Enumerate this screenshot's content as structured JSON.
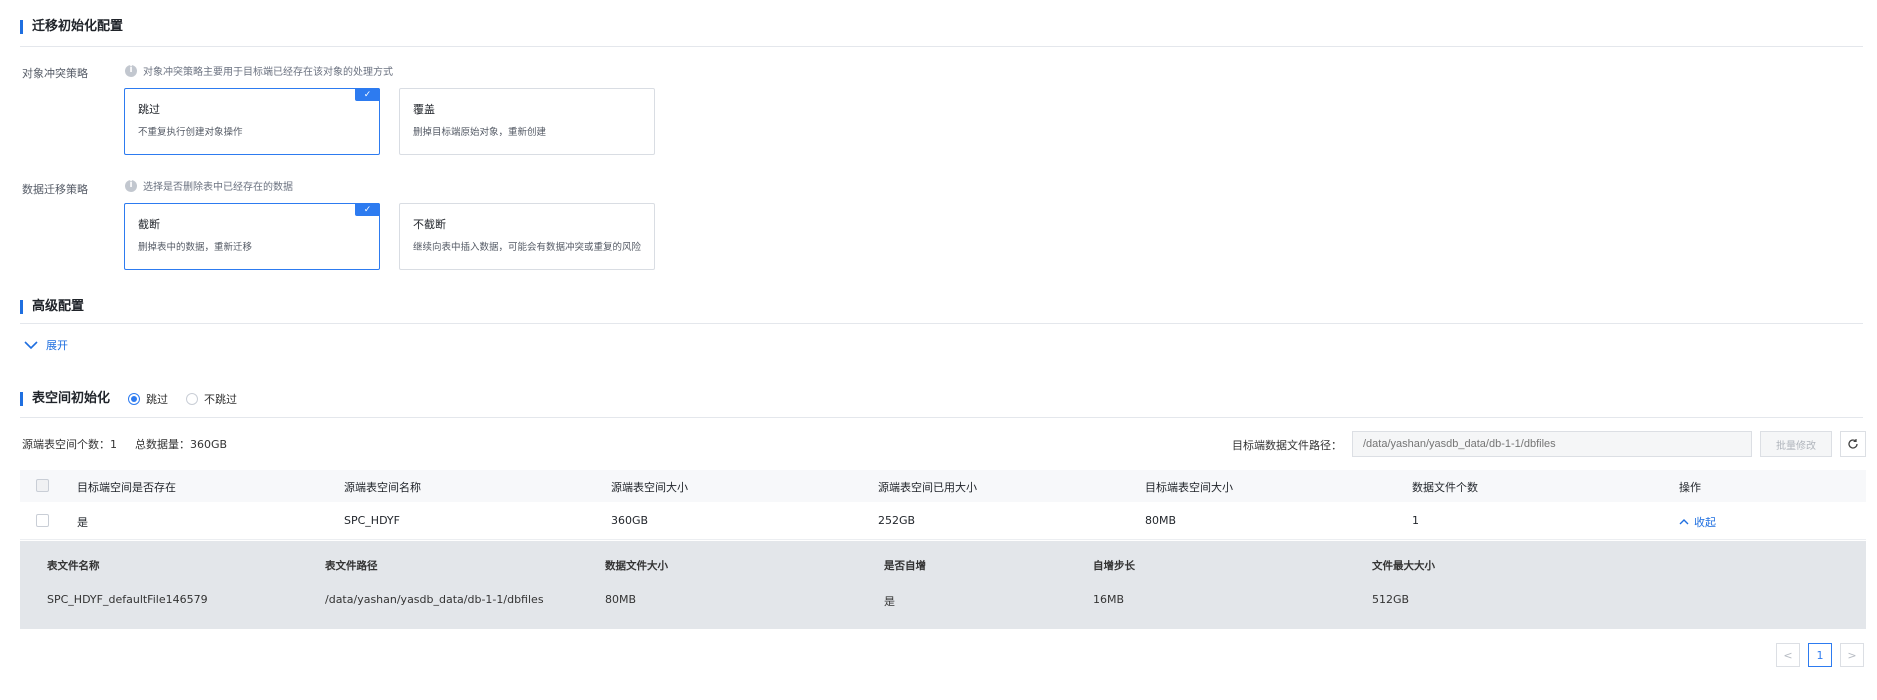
{
  "migration_init": {
    "title": "迁移初始化配置",
    "object_conflict": {
      "label": "对象冲突策略",
      "hint": "对象冲突策略主要用于目标端已经存在该对象的处理方式",
      "options": [
        {
          "title": "跳过",
          "desc": "不重复执行创建对象操作",
          "selected": true
        },
        {
          "title": "覆盖",
          "desc": "删掉目标端原始对象，重新创建",
          "selected": false
        }
      ]
    },
    "data_migration": {
      "label": "数据迁移策略",
      "hint": "选择是否删除表中已经存在的数据",
      "options": [
        {
          "title": "截断",
          "desc": "删掉表中的数据，重新迁移",
          "selected": true
        },
        {
          "title": "不截断",
          "desc": "继续向表中插入数据，可能会有数据冲突或重复的风险",
          "selected": false
        }
      ]
    }
  },
  "advanced": {
    "title": "高级配置",
    "expand_label": "展开"
  },
  "tablespace": {
    "title": "表空间初始化",
    "radio_skip": "跳过",
    "radio_noskip": "不跳过",
    "selected": "skip",
    "count_label": "源端表空间个数：1",
    "total_label": "总数据量：360GB",
    "path_label": "目标端数据文件路径：",
    "path_placeholder": "/data/yashan/yasdb_data/db-1-1/dbfiles",
    "batch_button": "批量修改",
    "columns": [
      "目标端空间是否存在",
      "源端表空间名称",
      "源端表空间大小",
      "源端表空间已用大小",
      "目标端表空间大小",
      "数据文件个数",
      "操作"
    ],
    "row": {
      "exists": "是",
      "name": "SPC_HDYF",
      "size": "360GB",
      "used": "252GB",
      "target_size": "80MB",
      "file_count": "1",
      "action": "收起"
    },
    "sub_columns": [
      "表文件名称",
      "表文件路径",
      "数据文件大小",
      "是否自增",
      "自增步长",
      "文件最大大小"
    ],
    "sub_row": {
      "file_name": "SPC_HDYF_defaultFile146579",
      "file_path": "/data/yashan/yasdb_data/db-1-1/dbfiles",
      "file_size": "80MB",
      "autoextend": "是",
      "step": "16MB",
      "max_size": "512GB"
    }
  },
  "pagination": {
    "prev": "<",
    "current": "1",
    "next": ">"
  },
  "colors": {
    "accent": "#2d7bf0",
    "subpanel_bg": "#e3e6ea"
  },
  "icons": {
    "check": "check-icon",
    "info": "info-icon",
    "chevron_down": "chevron-down-icon",
    "chevron_up": "chevron-up-icon",
    "refresh": "refresh-icon"
  }
}
